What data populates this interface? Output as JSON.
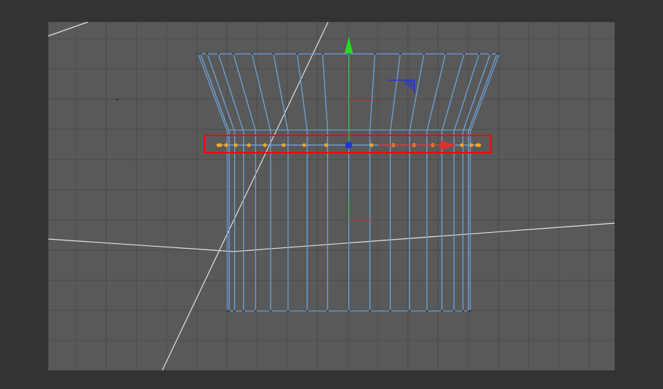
{
  "viewport": {
    "background": "#333333",
    "canvas_color": "#595959",
    "grid_color": "#4a4a4a",
    "wire_color": "#6fa3dc",
    "selected_point_color": "#f5a623",
    "selection_box_color": "#ff0000",
    "guide_line_color": "#e8e8e8",
    "axis_colors": {
      "x": "#e03030",
      "y": "#22dd22",
      "z": "#2233dd"
    }
  }
}
